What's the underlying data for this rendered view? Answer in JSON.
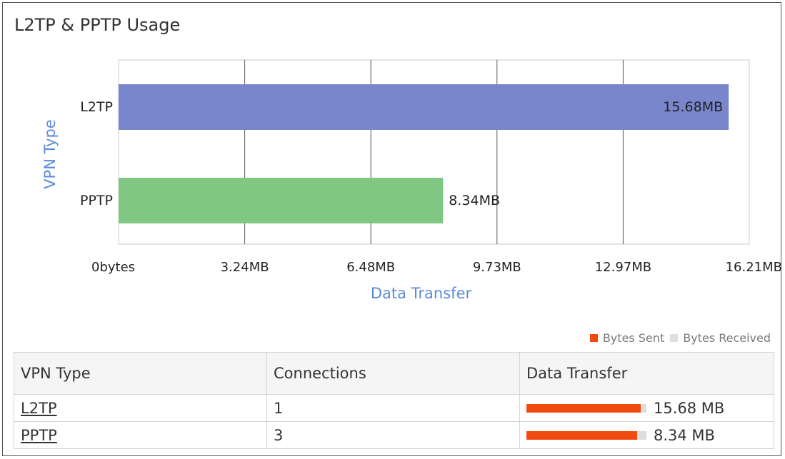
{
  "panel": {
    "title": "L2TP & PPTP Usage"
  },
  "chart_data": {
    "type": "bar",
    "orientation": "horizontal",
    "categories": [
      "L2TP",
      "PPTP"
    ],
    "values_mb": [
      15.68,
      8.34
    ],
    "value_labels": [
      "15.68MB",
      "8.34MB"
    ],
    "bar_colors": [
      "#7986cb",
      "#81c784"
    ],
    "xlabel": "Data Transfer",
    "ylabel": "VPN Type",
    "xlim": [
      0,
      16.21
    ],
    "x_ticks": [
      "0bytes",
      "3.24MB",
      "6.48MB",
      "9.73MB",
      "12.97MB",
      "16.21MB"
    ],
    "grid": true
  },
  "legend": {
    "items": [
      {
        "label": "Bytes Sent",
        "color": "#f04a0e"
      },
      {
        "label": "Bytes Received",
        "color": "#dedede"
      }
    ]
  },
  "table": {
    "headers": [
      "VPN Type",
      "Connections",
      "Data Transfer"
    ],
    "rows": [
      {
        "type": "L2TP",
        "connections": "1",
        "transfer": "15.68 MB",
        "sent_fraction": 0.95
      },
      {
        "type": "PPTP",
        "connections": "3",
        "transfer": "8.34 MB",
        "sent_fraction": 0.92
      }
    ]
  }
}
